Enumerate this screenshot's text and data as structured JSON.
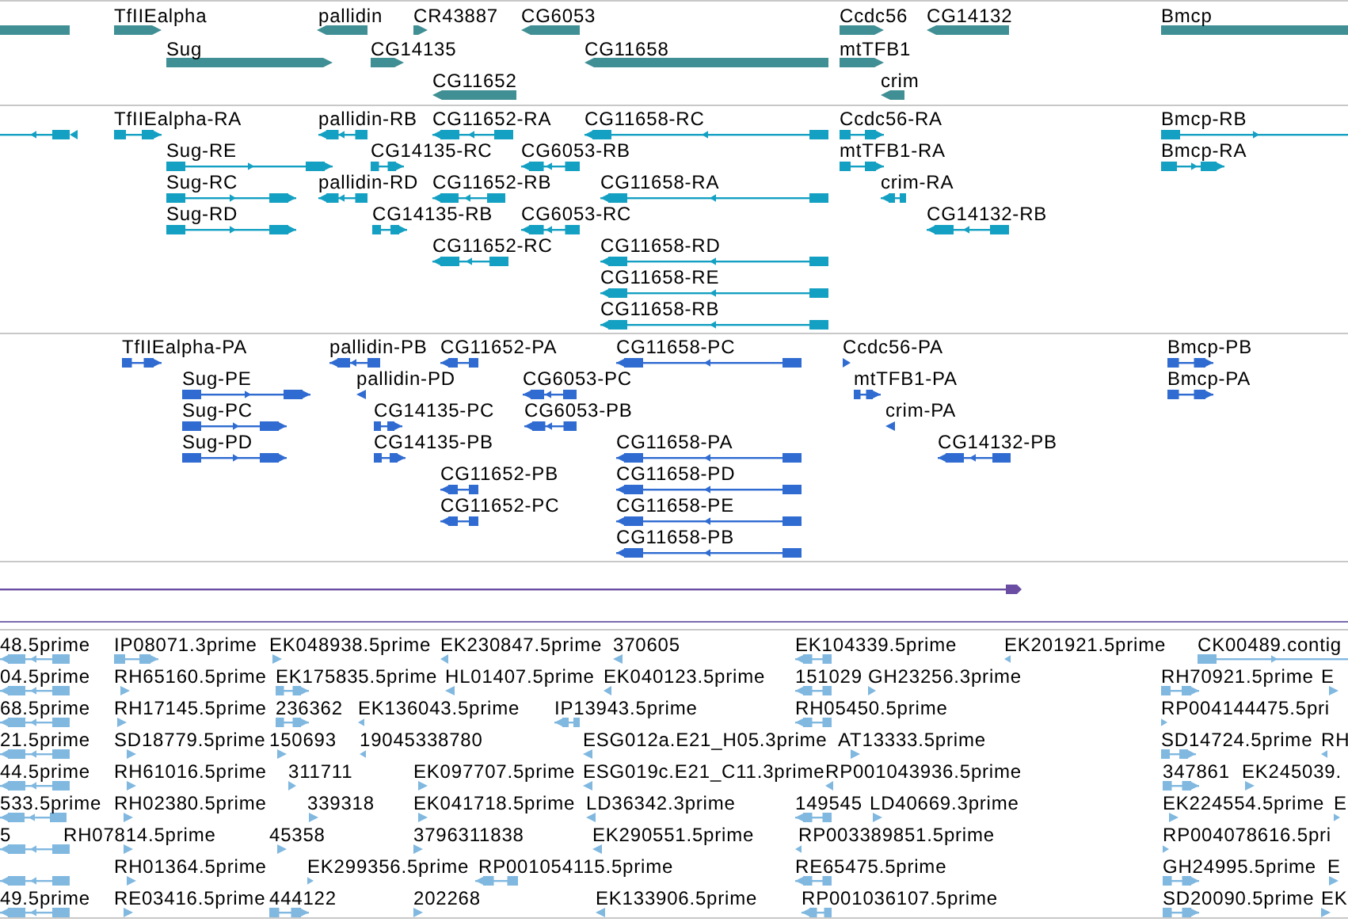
{
  "tracks": [
    {
      "kind": "genes",
      "features": [
        {
          "reverse": true
        },
        {
          "label": "TfIIEalpha",
          "reverse": false
        },
        {
          "label": "pallidin",
          "reverse": true
        },
        {
          "label": "CR43887",
          "reverse": false
        },
        {
          "label": "CG6053",
          "reverse": true
        },
        {
          "label": "Ccdc56",
          "reverse": false
        },
        {
          "label": "CG14132",
          "reverse": true
        },
        {
          "label": "Bmcp",
          "reverse": false
        },
        {
          "label": "Sug",
          "reverse": false
        },
        {
          "label": "CG14135",
          "reverse": false
        },
        {
          "label": "CG11658",
          "reverse": true
        },
        {
          "label": "mtTFB1",
          "reverse": false
        },
        {
          "label": "CG11652",
          "reverse": true
        },
        {
          "label": "crim",
          "reverse": true
        }
      ]
    },
    {
      "kind": "transcripts",
      "features": [
        {
          "reverse": true
        },
        {
          "label": "TfIIEalpha-RA",
          "reverse": false
        },
        {
          "label": "pallidin-RB",
          "reverse": true
        },
        {
          "label": "CG11652-RA",
          "reverse": true
        },
        {
          "label": "CG11658-RC",
          "reverse": true
        },
        {
          "label": "Ccdc56-RA",
          "reverse": false
        },
        {
          "label": "Bmcp-RB",
          "reverse": false
        },
        {
          "label": "Sug-RE",
          "reverse": false
        },
        {
          "label": "CG14135-RC",
          "reverse": false
        },
        {
          "label": "CG6053-RB",
          "reverse": true
        },
        {
          "label": "mtTFB1-RA",
          "reverse": false
        },
        {
          "label": "Bmcp-RA",
          "reverse": false
        },
        {
          "label": "Sug-RC",
          "reverse": false
        },
        {
          "label": "pallidin-RD",
          "reverse": true
        },
        {
          "label": "CG11652-RB",
          "reverse": true
        },
        {
          "label": "CG11658-RA",
          "reverse": true
        },
        {
          "label": "crim-RA",
          "reverse": true
        },
        {
          "label": "Sug-RD",
          "reverse": false
        },
        {
          "label": "CG14135-RB",
          "reverse": false
        },
        {
          "label": "CG6053-RC",
          "reverse": true
        },
        {
          "label": "CG14132-RB",
          "reverse": true
        },
        {
          "label": "CG11652-RC",
          "reverse": true
        },
        {
          "label": "CG11658-RD",
          "reverse": true
        },
        {
          "label": "CG11658-RE",
          "reverse": true
        },
        {
          "label": "CG11658-RB",
          "reverse": true
        }
      ]
    },
    {
      "kind": "proteins",
      "features": [
        {
          "label": "TfIIEalpha-PA",
          "reverse": false
        },
        {
          "label": "pallidin-PB",
          "reverse": true
        },
        {
          "label": "CG11652-PA",
          "reverse": true
        },
        {
          "label": "CG11658-PC",
          "reverse": true
        },
        {
          "label": "Ccdc56-PA",
          "reverse": false
        },
        {
          "label": "Bmcp-PB",
          "reverse": false
        },
        {
          "label": "Sug-PE",
          "reverse": false
        },
        {
          "label": "pallidin-PD",
          "reverse": true
        },
        {
          "label": "CG6053-PC",
          "reverse": true
        },
        {
          "label": "mtTFB1-PA",
          "reverse": false
        },
        {
          "label": "Bmcp-PA",
          "reverse": false
        },
        {
          "label": "Sug-PC",
          "reverse": false
        },
        {
          "label": "CG14135-PC",
          "reverse": false
        },
        {
          "label": "CG6053-PB",
          "reverse": true
        },
        {
          "label": "crim-PA",
          "reverse": true
        },
        {
          "label": "Sug-PD",
          "reverse": false
        },
        {
          "label": "CG14135-PB",
          "reverse": false
        },
        {
          "label": "CG11658-PA",
          "reverse": true
        },
        {
          "label": "CG14132-PB",
          "reverse": true
        },
        {
          "label": "CG11652-PB",
          "reverse": true
        },
        {
          "label": "CG11658-PD",
          "reverse": true
        },
        {
          "label": "CG11652-PC",
          "reverse": true
        },
        {
          "label": "CG11658-PE",
          "reverse": true
        },
        {
          "label": "CG11658-PB",
          "reverse": true
        }
      ]
    },
    {
      "kind": "contig",
      "features": [
        {
          "reverse": false
        }
      ]
    },
    {
      "kind": "ests",
      "features": [
        {
          "label": "48.5prime",
          "reverse": true
        },
        {
          "label": "IP08071.3prime",
          "reverse": false
        },
        {
          "label": "EK048938.5prime",
          "reverse": false
        },
        {
          "label": "EK230847.5prime",
          "reverse": true
        },
        {
          "label": "370605",
          "reverse": true
        },
        {
          "label": "EK104339.5prime",
          "reverse": true
        },
        {
          "label": "EK201921.5prime",
          "reverse": true
        },
        {
          "label": "CK00489.contig",
          "reverse": false
        },
        {
          "label": "04.5prime",
          "reverse": true
        },
        {
          "label": "RH65160.5prime",
          "reverse": false
        },
        {
          "label": "EK175835.5prime",
          "reverse": false
        },
        {
          "label": "HL01407.5prime",
          "reverse": true
        },
        {
          "label": "EK040123.5prime",
          "reverse": true
        },
        {
          "label": "151029",
          "reverse": true
        },
        {
          "label": "GH23256.3prime",
          "reverse": false
        },
        {
          "label": "RH70921.5prime",
          "reverse": false
        },
        {
          "label": "E",
          "reverse": false
        },
        {
          "label": "68.5prime",
          "reverse": true
        },
        {
          "label": "RH17145.5prime",
          "reverse": false
        },
        {
          "label": "236362",
          "reverse": false
        },
        {
          "label": "EK136043.5prime",
          "reverse": true
        },
        {
          "label": "IP13943.5prime",
          "reverse": true
        },
        {
          "label": "RH05450.5prime",
          "reverse": true
        },
        {
          "label": "RP004144475.5pri",
          "reverse": false
        },
        {
          "label": "21.5prime",
          "reverse": true
        },
        {
          "label": "SD18779.5prime",
          "reverse": false
        },
        {
          "label": "150693",
          "reverse": false
        },
        {
          "label": "19045338780",
          "reverse": true
        },
        {
          "label": "ESG012a.E21_H05.3prime",
          "reverse": true
        },
        {
          "label": "AT13333.5prime",
          "reverse": false
        },
        {
          "label": "SD14724.5prime",
          "reverse": false
        },
        {
          "label": "RH",
          "reverse": true
        },
        {
          "label": "44.5prime",
          "reverse": true
        },
        {
          "label": "RH61016.5prime",
          "reverse": false
        },
        {
          "label": "311711",
          "reverse": false
        },
        {
          "label": "EK097707.5prime",
          "reverse": false
        },
        {
          "label": "ESG019c.E21_C11.3prime",
          "reverse": true
        },
        {
          "label": "RP001043936.5prime",
          "reverse": true
        },
        {
          "label": "347861",
          "reverse": false
        },
        {
          "label": "EK245039.",
          "reverse": false
        },
        {
          "label": "533.5prime",
          "reverse": true
        },
        {
          "label": "RH02380.5prime",
          "reverse": false
        },
        {
          "label": "339318",
          "reverse": false
        },
        {
          "label": "EK041718.5prime",
          "reverse": false
        },
        {
          "label": "LD36342.3prime",
          "reverse": true
        },
        {
          "label": "149545",
          "reverse": true
        },
        {
          "label": "LD40669.3prime",
          "reverse": false
        },
        {
          "label": "EK224554.5prime",
          "reverse": false
        },
        {
          "label": "E",
          "reverse": false
        },
        {
          "label": "5",
          "reverse": true
        },
        {
          "label": "RH07814.5prime",
          "reverse": false
        },
        {
          "label": "45358",
          "reverse": false
        },
        {
          "label": "3796311838",
          "reverse": false
        },
        {
          "label": "EK290551.5prime",
          "reverse": true
        },
        {
          "label": "RP003389851.5prime",
          "reverse": true
        },
        {
          "label": "RP004078616.5pri",
          "reverse": false
        },
        {
          "reverse": true
        },
        {
          "label": "RH01364.5prime",
          "reverse": false
        },
        {
          "label": "EK299356.5prime",
          "reverse": false
        },
        {
          "label": "RP001054115.5prime",
          "reverse": true
        },
        {
          "label": "RE65475.5prime",
          "reverse": true
        },
        {
          "label": "GH24995.5prime",
          "reverse": false
        },
        {
          "label": "E",
          "reverse": false
        },
        {
          "label": "49.5prime",
          "reverse": true
        },
        {
          "label": "RE03416.5prime",
          "reverse": false
        },
        {
          "label": "444122",
          "reverse": false
        },
        {
          "label": "202268",
          "reverse": false
        },
        {
          "label": "EK133906.5prime",
          "reverse": true
        },
        {
          "label": "RP001036107.5prime",
          "reverse": true
        },
        {
          "label": "SD20090.5prime",
          "reverse": false
        },
        {
          "label": "EK",
          "reverse": false
        }
      ]
    }
  ]
}
